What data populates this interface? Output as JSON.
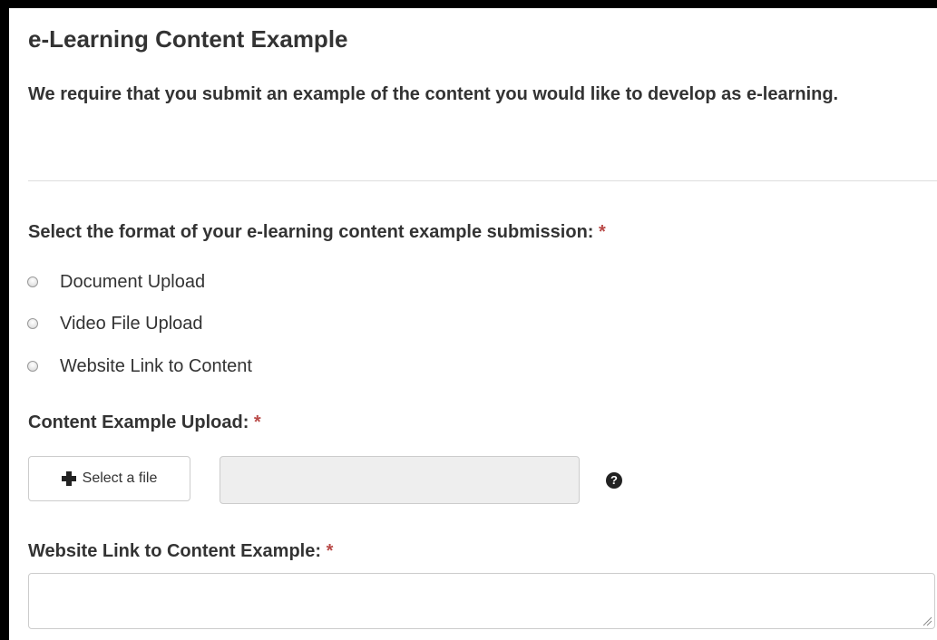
{
  "section": {
    "title": "e-Learning Content Example",
    "intro": "We require that you submit an example of the content you would like to develop as e-learning."
  },
  "format_question": {
    "label": "Select the format of your e-learning content example submission:",
    "required_mark": "*",
    "options": [
      {
        "label": "Document Upload",
        "selected": false
      },
      {
        "label": "Video File Upload",
        "selected": false
      },
      {
        "label": "Website Link to Content",
        "selected": false
      }
    ]
  },
  "upload_field": {
    "label": "Content Example Upload:",
    "required_mark": "*",
    "button_label": "Select a file",
    "button_icon": "plus-icon",
    "file_path_value": "",
    "help_icon": "question-circle-icon",
    "help_glyph": "?"
  },
  "link_field": {
    "label": "Website Link to Content Example:",
    "required_mark": "*",
    "value": "",
    "resize_icon": "resize-grip-icon"
  },
  "colors": {
    "text": "#333333",
    "required": "#b94a48",
    "border": "#cccccc",
    "readonly_bg": "#eeeeee",
    "frame_border": "#000000"
  }
}
